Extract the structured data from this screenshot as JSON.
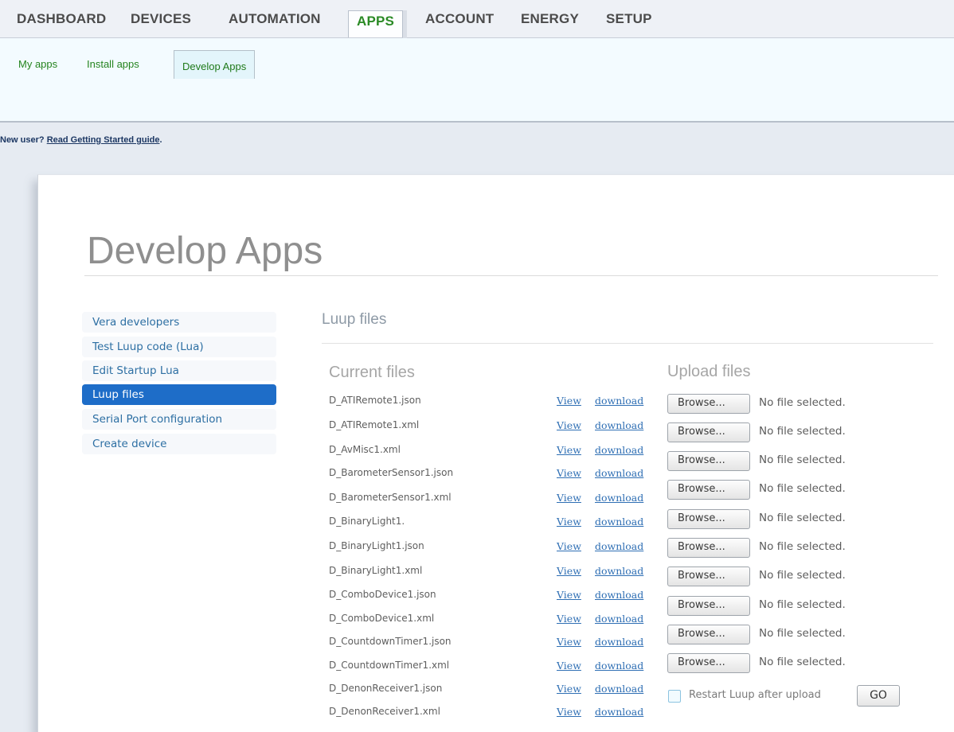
{
  "topnav": {
    "tabs": [
      "DASHBOARD",
      "DEVICES",
      "AUTOMATION",
      "APPS",
      "ACCOUNT",
      "ENERGY",
      "SETUP"
    ],
    "active": "APPS"
  },
  "subnav": {
    "items": [
      "My apps",
      "Install apps",
      "Develop Apps"
    ],
    "active": "Develop Apps"
  },
  "newuser": {
    "prefix": "New user? ",
    "link": "Read Getting Started guide",
    "suffix": "."
  },
  "page": {
    "title": "Develop Apps"
  },
  "leftmenu": {
    "items": [
      "Vera developers",
      "Test Luup code (Lua)",
      "Edit Startup Lua",
      "Luup files",
      "Serial Port configuration",
      "Create device"
    ],
    "active": "Luup files"
  },
  "luup": {
    "section_title": "Luup files",
    "current_heading": "Current files",
    "upload_heading": "Upload files",
    "view_label": "View",
    "download_label": "download",
    "files": [
      "D_ATIRemote1.json",
      "D_ATIRemote1.xml",
      "D_AvMisc1.xml",
      "D_BarometerSensor1.json",
      "D_BarometerSensor1.xml",
      "D_BinaryLight1.",
      "D_BinaryLight1.json",
      "D_BinaryLight1.xml",
      "D_ComboDevice1.json",
      "D_ComboDevice1.xml",
      "D_CountdownTimer1.json",
      "D_CountdownTimer1.xml",
      "D_DenonReceiver1.json",
      "D_DenonReceiver1.xml"
    ],
    "browse_label": "Browse...",
    "no_file_label": "No file selected.",
    "upload_slots": 11,
    "restart_label": "Restart Luup after upload",
    "restart_checked": false,
    "go_label": "GO"
  },
  "colors": {
    "accent_green": "#2a8a25",
    "link_blue": "#2f6fb4",
    "active_menu_bg": "#1e6dc8"
  }
}
